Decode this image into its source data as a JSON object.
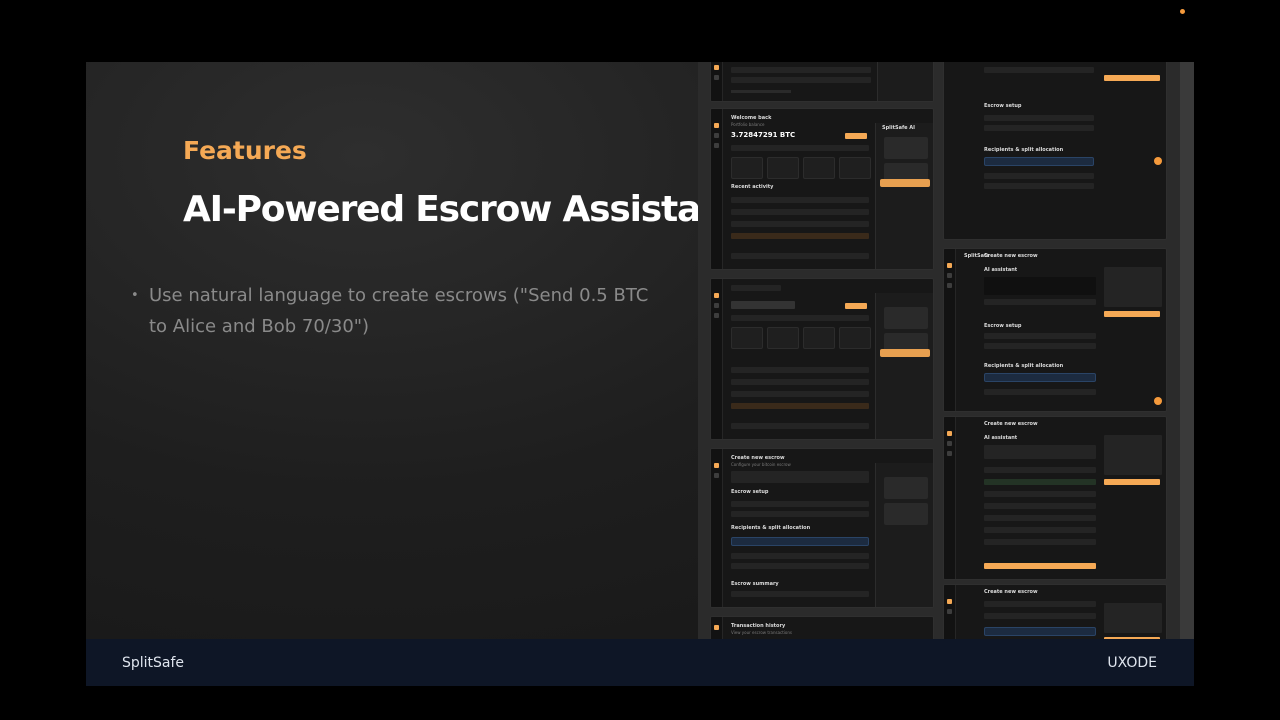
{
  "slide": {
    "kicker": "Features",
    "title": "AI-Powered Escrow Assistant",
    "bullets": [
      "Use natural language to create escrows (\"Send 0.5 BTC to Alice and Bob 70/30\")"
    ]
  },
  "footer": {
    "brand": "SplitSafe",
    "credit": "UXODE"
  },
  "gallery": {
    "dashboard": {
      "title": "Welcome back",
      "balance": "3.72847291 BTC",
      "section": "Recent activity",
      "assistant": "SplitSafe AI"
    },
    "create_escrow": {
      "title": "Create new escrow",
      "ai_section": "AI assistant",
      "setup_section": "Escrow setup",
      "recipients_section": "Recipients & split allocation",
      "summary_section": "Escrow summary",
      "brand": "SplitSafe"
    },
    "history": {
      "title": "Transaction history"
    }
  },
  "colors": {
    "accent": "#f5a955",
    "footer_bg": "#0e1626",
    "bullet_text": "#8a8a8a"
  }
}
